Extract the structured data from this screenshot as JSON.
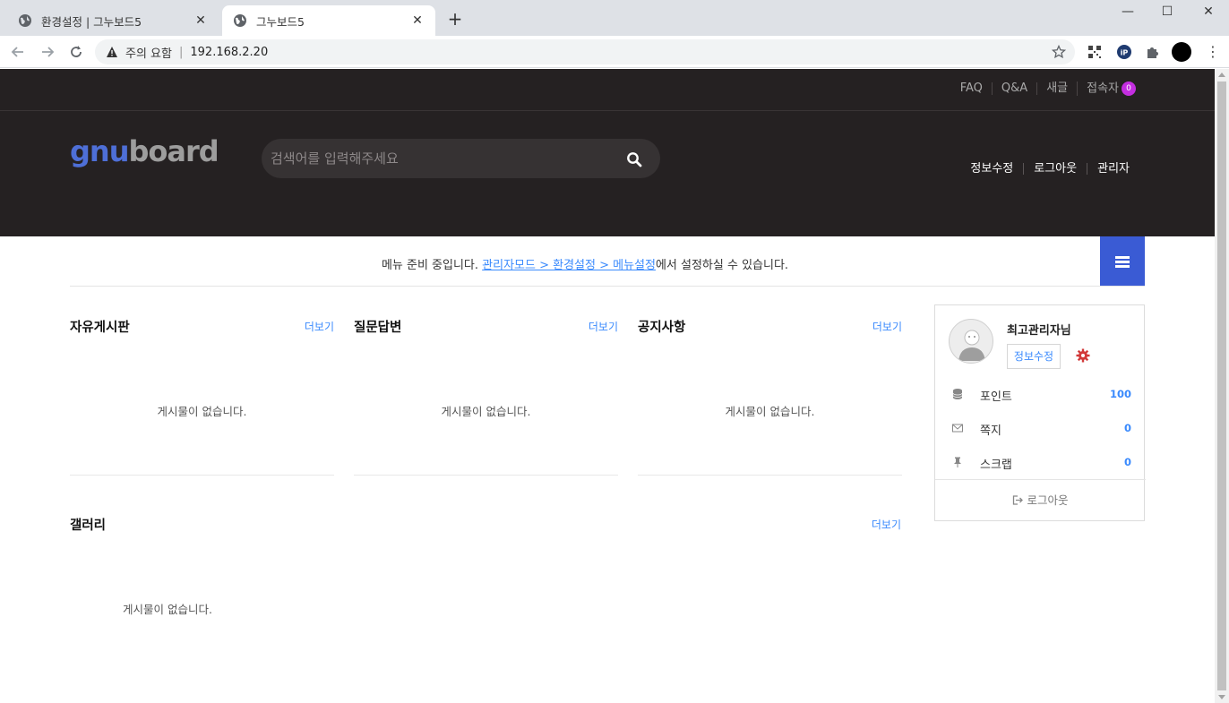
{
  "browser": {
    "tabs": [
      {
        "title": "환경설정 | 그누보드5",
        "active": false
      },
      {
        "title": "그누보드5",
        "active": true
      }
    ],
    "address": {
      "security_label": "주의 요함",
      "url": "192.168.2.20"
    }
  },
  "topbar": {
    "links": [
      "FAQ",
      "Q&A",
      "새글",
      "접속자"
    ],
    "visitor_count": "0"
  },
  "header": {
    "logo_part1": "gnu",
    "logo_part2": "board",
    "search_placeholder": "검색어를 입력해주세요",
    "user_menu": [
      "정보수정",
      "로그아웃",
      "관리자"
    ]
  },
  "notice": {
    "prefix": "메뉴 준비 중입니다. ",
    "link_text": "관리자모드 > 환경설정 > 메뉴설정",
    "suffix": "에서 설정하실 수 있습니다."
  },
  "boards": [
    {
      "title": "자유게시판",
      "more": "더보기",
      "empty": "게시물이 없습니다."
    },
    {
      "title": "질문답변",
      "more": "더보기",
      "empty": "게시물이 없습니다."
    },
    {
      "title": "공지사항",
      "more": "더보기",
      "empty": "게시물이 없습니다."
    },
    {
      "title": "갤러리",
      "more": "더보기",
      "empty": "게시물이 없습니다."
    }
  ],
  "profile": {
    "name": "최고관리자님",
    "edit_label": "정보수정",
    "rows": [
      {
        "label": "포인트",
        "value": "100",
        "icon": "database-icon"
      },
      {
        "label": "쪽지",
        "value": "0",
        "icon": "envelope-icon"
      },
      {
        "label": "스크랩",
        "value": "0",
        "icon": "pin-icon"
      }
    ],
    "logout_label": "로그아웃"
  },
  "colors": {
    "header_bg": "#252122",
    "accent_blue": "#3a5bd4",
    "link_blue": "#3a8afd",
    "badge_purple": "#c42ee0",
    "gear_red": "#d23a3a"
  }
}
